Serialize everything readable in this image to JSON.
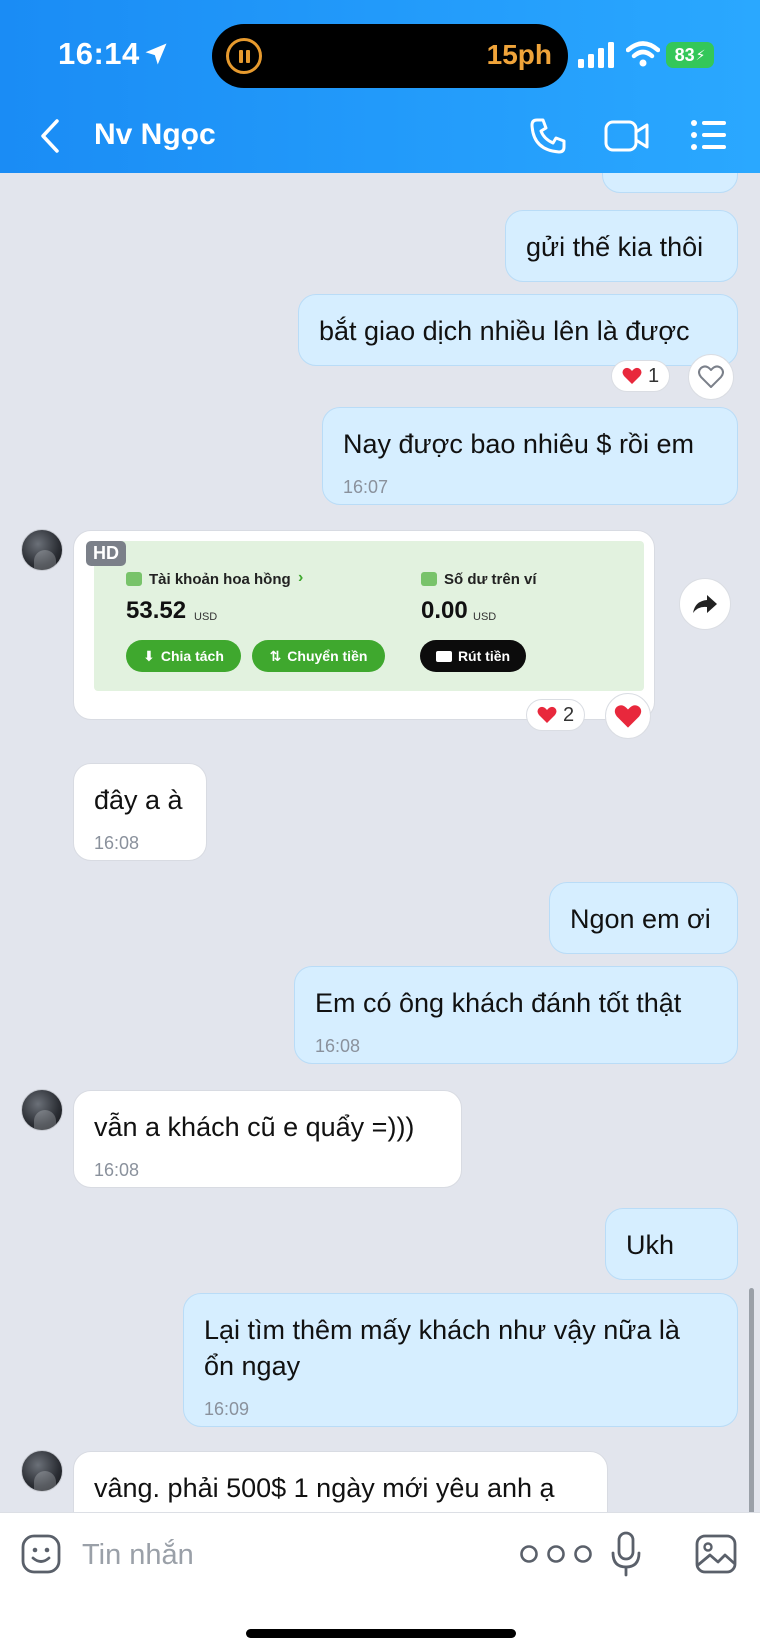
{
  "status_bar": {
    "time": "16:14",
    "activity_timer": "15ph",
    "battery": "83"
  },
  "header": {
    "contact_name": "Nv Ngọc"
  },
  "messages": [
    {
      "text": "gửi thế kia thôi"
    },
    {
      "text": "bắt giao dịch nhiều lên là được",
      "reaction": {
        "emoji": "heart",
        "count": "1"
      }
    },
    {
      "text": "Nay được bao nhiêu $ rồi em",
      "time": "16:07"
    },
    {
      "text": "đây a à",
      "time": "16:08"
    },
    {
      "text": "Ngon em ơi"
    },
    {
      "text": "Em có ông khách đánh tốt thật",
      "time": "16:08"
    },
    {
      "text": "vẫn a khách cũ e quẩy =)))",
      "time": "16:08"
    },
    {
      "text": "Ukh"
    },
    {
      "text": "Lại tìm thêm mấy khách như vậy nữa là ổn ngay",
      "time": "16:09"
    },
    {
      "text": "vâng. phải 500$ 1 ngày mới yêu anh ạ"
    }
  ],
  "image_message": {
    "badge": "HD",
    "reaction": {
      "emoji": "heart",
      "count": "2"
    },
    "screenshot": {
      "commission_label": "Tài khoản hoa hồng",
      "commission_amount": "53.52",
      "commission_currency": "USD",
      "wallet_label": "Số dư trên ví",
      "wallet_amount": "0.00",
      "wallet_currency": "USD",
      "split_button": "Chia tách",
      "transfer_button": "Chuyển tiền",
      "withdraw_button": "Rút tiền"
    }
  },
  "composer": {
    "placeholder": "Tin nhắn"
  },
  "colors": {
    "header": "#1a8cf5",
    "sent_bubble": "#d6eeff",
    "received_bubble": "#ffffff",
    "heart": "#e8283c"
  }
}
